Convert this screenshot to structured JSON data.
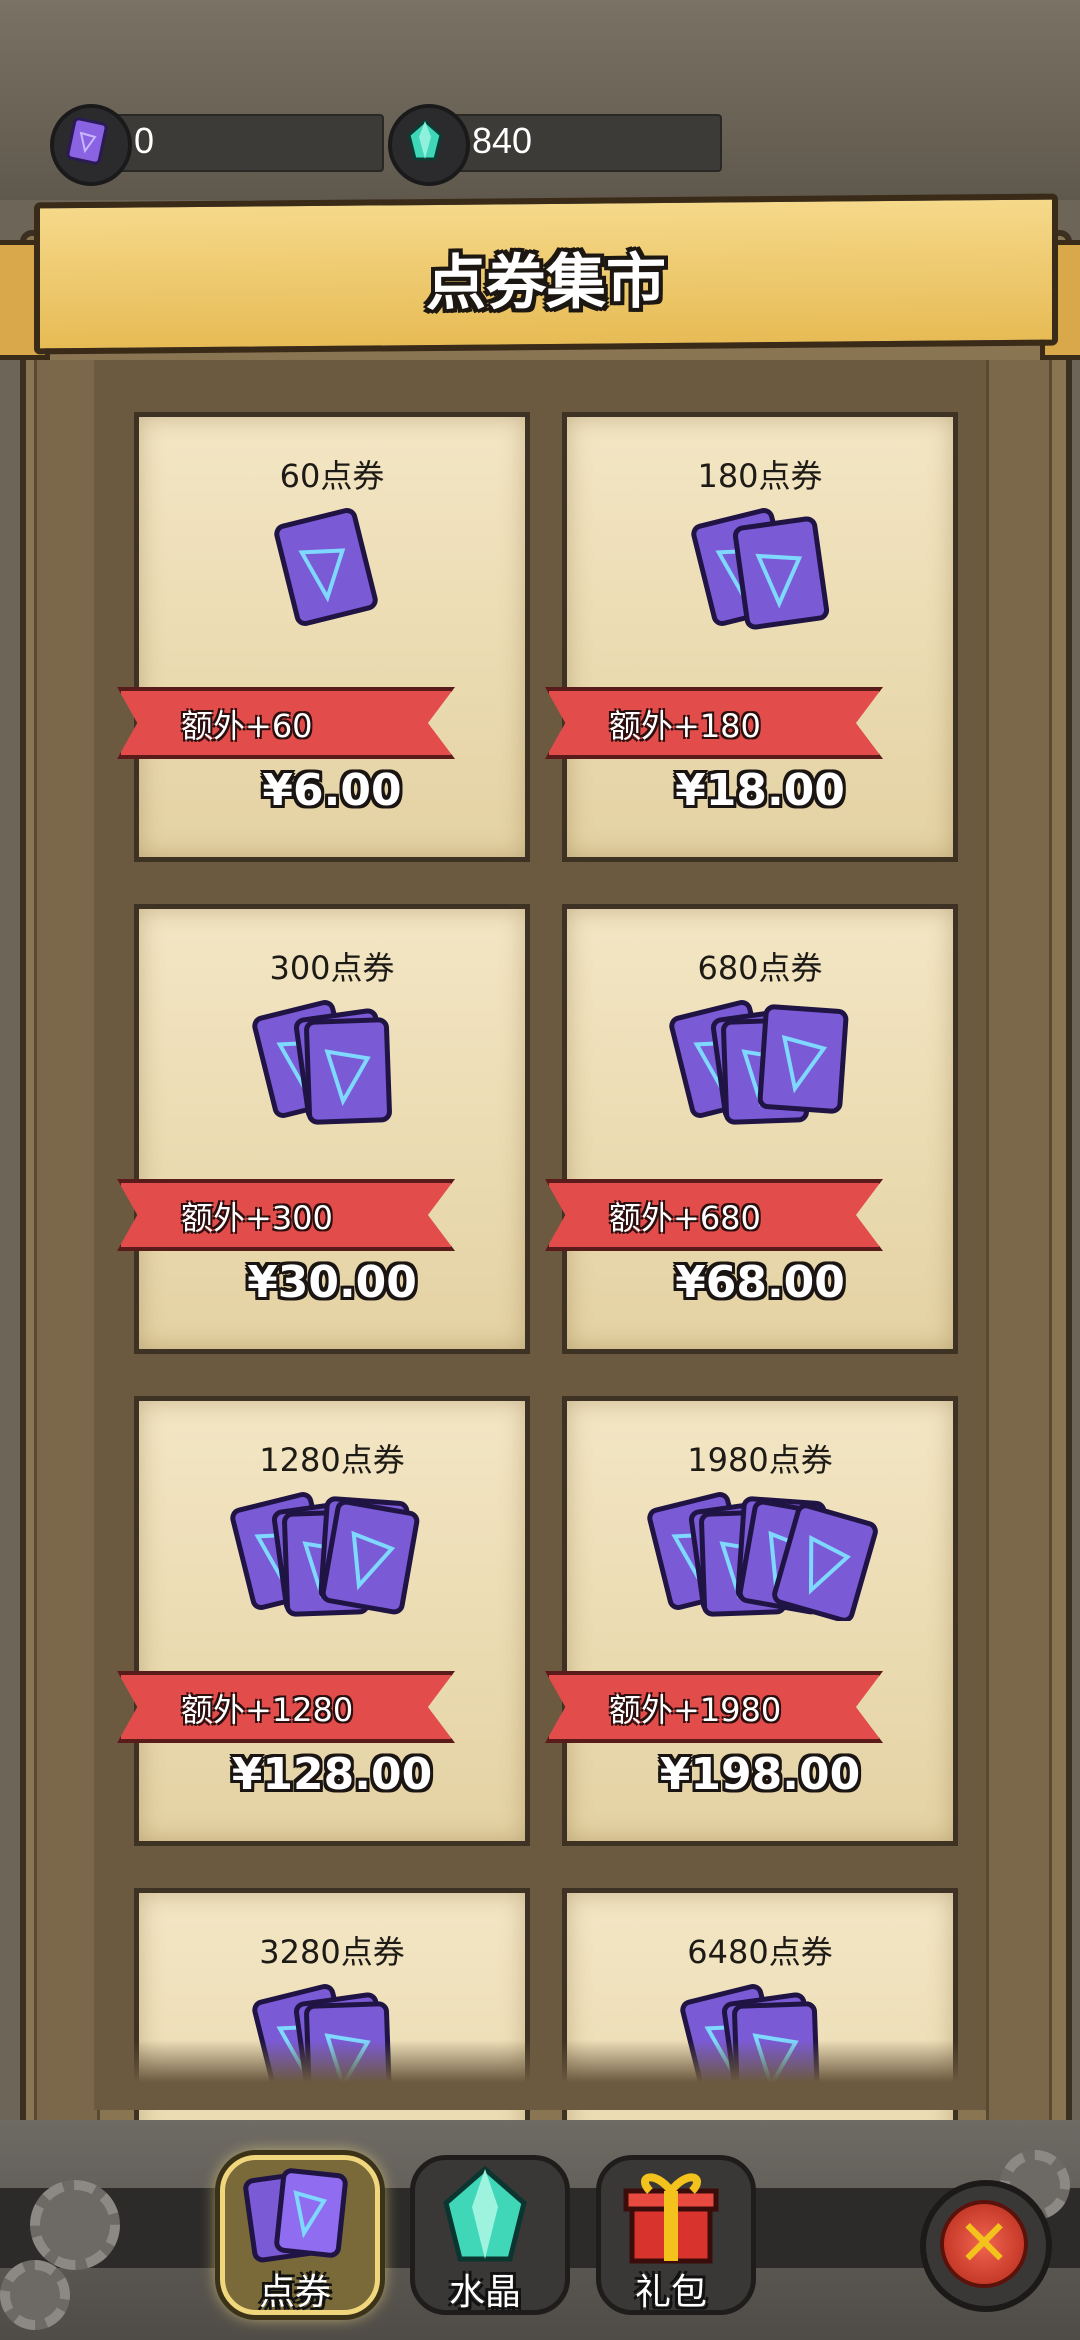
{
  "currencies": [
    {
      "icon": "purple-voucher-icon",
      "value": "0"
    },
    {
      "icon": "teal-crystal-icon",
      "value": "840"
    }
  ],
  "header": {
    "title": "点券集市"
  },
  "products": [
    {
      "title": "60点券",
      "bonus": "额外+60",
      "price": "¥6.00",
      "card_count": 1
    },
    {
      "title": "180点券",
      "bonus": "额外+180",
      "price": "¥18.00",
      "card_count": 2
    },
    {
      "title": "300点券",
      "bonus": "额外+300",
      "price": "¥30.00",
      "card_count": 3
    },
    {
      "title": "680点券",
      "bonus": "额外+680",
      "price": "¥68.00",
      "card_count": 4
    },
    {
      "title": "1280点券",
      "bonus": "额外+1280",
      "price": "¥128.00",
      "card_count": 5
    },
    {
      "title": "1980点券",
      "bonus": "额外+1980",
      "price": "¥198.00",
      "card_count": 6
    },
    {
      "title": "3280点券",
      "bonus": "",
      "price": "",
      "card_count": 3
    },
    {
      "title": "6480点券",
      "bonus": "",
      "price": "",
      "card_count": 3
    }
  ],
  "tabs": [
    {
      "label": "点券",
      "icon": "voucher-tab-icon",
      "active": true
    },
    {
      "label": "水晶",
      "icon": "crystal-tab-icon",
      "active": false
    },
    {
      "label": "礼包",
      "icon": "gift-tab-icon",
      "active": false
    }
  ],
  "close_button": {
    "icon": "close-icon"
  },
  "colors": {
    "ribbon": "#e24c4b",
    "card": "#efe0b9",
    "banner": "#f0cc6e",
    "frame": "#8a7552",
    "voucher": "#7b5ad6"
  }
}
